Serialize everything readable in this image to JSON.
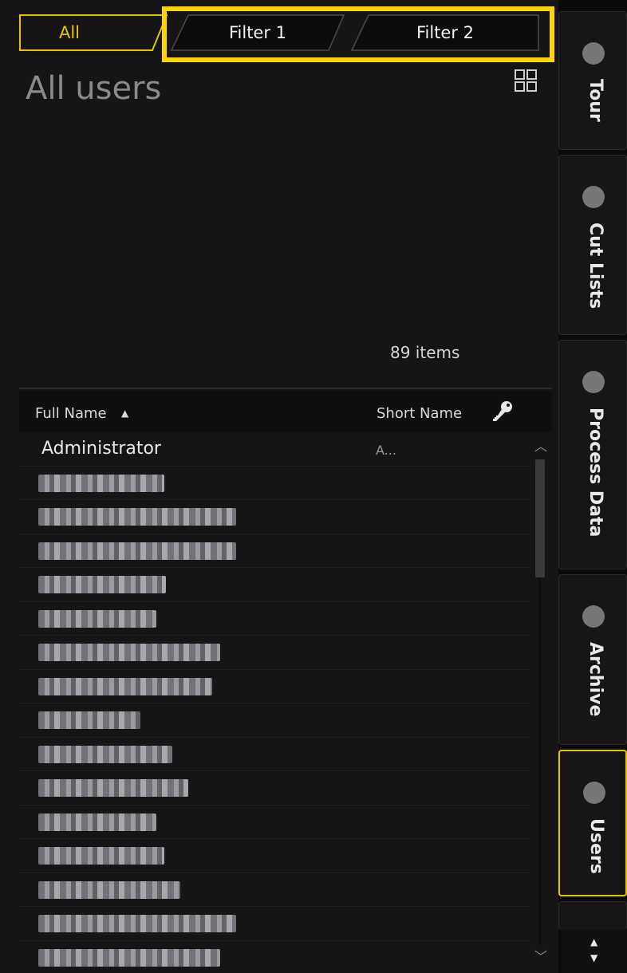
{
  "tabs": [
    {
      "label": "All",
      "active": true
    },
    {
      "label": "Filter 1",
      "active": false
    },
    {
      "label": "Filter 2",
      "active": false
    }
  ],
  "header": {
    "title": "All users",
    "item_count": "89 items",
    "view_toggle_icon": "grid-icon"
  },
  "table": {
    "columns": {
      "full_name": "Full Name",
      "sort_indicator": "▲",
      "short_name": "Short Name",
      "key_icon": "key-icon"
    },
    "rows": [
      {
        "full_name": "Administrator",
        "short_name": "A..."
      }
    ],
    "redacted_rows": 15
  },
  "side_tabs": [
    {
      "label": "Tour",
      "active": false
    },
    {
      "label": "Cut Lists",
      "active": false
    },
    {
      "label": "Process Data",
      "active": false
    },
    {
      "label": "Archive",
      "active": false
    },
    {
      "label": "Users",
      "active": true
    }
  ],
  "colors": {
    "accent": "#e7c300",
    "highlight": "#ffd400",
    "background": "#151515"
  }
}
